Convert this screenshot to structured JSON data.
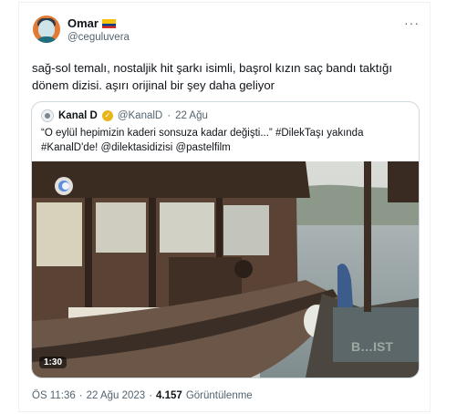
{
  "author": {
    "display_name": "Omar",
    "handle": "@ceguluvera",
    "avatar_icon": "user-avatar-icon",
    "flag_icon": "flag-icon"
  },
  "tweet": {
    "text": "sağ-sol temalı, nostaljik hit şarkı isimli, başrol kızın saç bandı taktığı dönem dizisi. aşırı orijinal bir şey daha geliyor",
    "more_icon": "more-options-icon"
  },
  "quote": {
    "display_name": "Kanal D",
    "verified_badge": "verified-badge-icon",
    "handle": "@KanalD",
    "separator": "·",
    "date": "22 Ağu",
    "text": "“O eylül hepimizin kaderi sonsuza kadar değişti...” #DilekTaşı yakında #KanalD'de! @dilektasidizisi @pastelfilm",
    "video": {
      "duration": "1:30",
      "watermark_text": "B…IST"
    }
  },
  "footer": {
    "time": "ÖS 11:36",
    "separator": "·",
    "date": "22 Ağu 2023",
    "separator2": "·",
    "views_count": "4.157",
    "views_label": "Görüntülenme"
  }
}
